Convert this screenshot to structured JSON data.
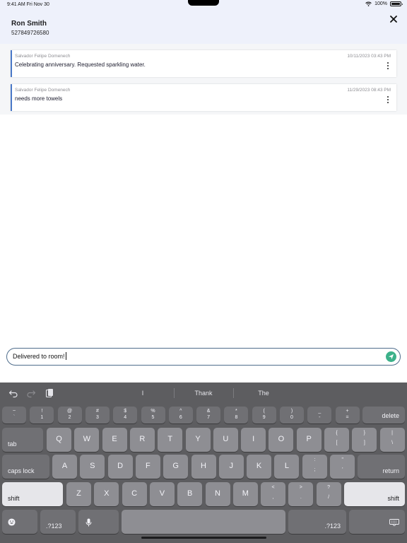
{
  "status": {
    "time": "9:41 AM  Fri Nov 30",
    "battery": "100%"
  },
  "header": {
    "guest_name": "Ron Smith",
    "phone": "527849726580"
  },
  "notes": [
    {
      "author": "Salvador Felipe Domenech",
      "date": "10/11/2023 03:43 PM",
      "text": "Celebrating anniversary. Requested sparkling water."
    },
    {
      "author": "Salvador Felipe Domenech",
      "date": "11/29/2023 08:43 PM",
      "text": "needs more towels"
    }
  ],
  "input": {
    "value": "Delivered to room!"
  },
  "keyboard": {
    "suggestions": [
      "I",
      "Thank",
      "The"
    ],
    "number_row": [
      {
        "top": "~",
        "bottom": "`"
      },
      {
        "top": "!",
        "bottom": "1"
      },
      {
        "top": "@",
        "bottom": "2"
      },
      {
        "top": "#",
        "bottom": "3"
      },
      {
        "top": "$",
        "bottom": "4"
      },
      {
        "top": "%",
        "bottom": "5"
      },
      {
        "top": "^",
        "bottom": "6"
      },
      {
        "top": "&",
        "bottom": "7"
      },
      {
        "top": "*",
        "bottom": "8"
      },
      {
        "top": "(",
        "bottom": "9"
      },
      {
        "top": ")",
        "bottom": "0"
      },
      {
        "top": "_",
        "bottom": "-"
      },
      {
        "top": "+",
        "bottom": "="
      }
    ],
    "delete": "delete",
    "tab": "tab",
    "row_q": [
      "Q",
      "W",
      "E",
      "R",
      "T",
      "Y",
      "U",
      "I",
      "O",
      "P"
    ],
    "row_q_symbols": [
      {
        "top": "{",
        "bottom": "["
      },
      {
        "top": "}",
        "bottom": "]"
      },
      {
        "top": "|",
        "bottom": "\\"
      }
    ],
    "caps_lock": "caps lock",
    "row_a": [
      "A",
      "S",
      "D",
      "F",
      "G",
      "H",
      "J",
      "K",
      "L"
    ],
    "row_a_symbols": [
      {
        "top": ":",
        "bottom": ";"
      },
      {
        "top": "\"",
        "bottom": "'"
      }
    ],
    "return": "return",
    "shift": "shift",
    "row_z": [
      "Z",
      "X",
      "C",
      "V",
      "B",
      "N",
      "M"
    ],
    "row_z_symbols": [
      {
        "top": "<",
        "bottom": ","
      },
      {
        "top": ">",
        "bottom": "."
      },
      {
        "top": "?",
        "bottom": "/"
      }
    ],
    "numbers_label": ".?123"
  },
  "colors": {
    "header_bg": "#eef1fb",
    "accent": "#4a78c8",
    "send": "#3cb18a",
    "keyboard_bg": "#5d5d60"
  }
}
